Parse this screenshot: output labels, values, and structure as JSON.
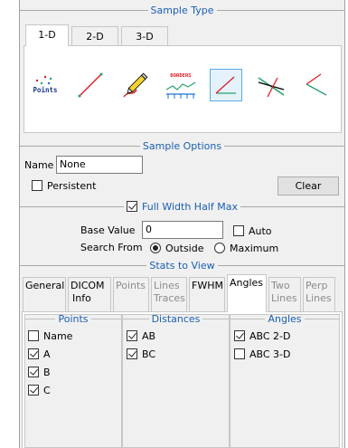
{
  "sample_type": {
    "title": "Sample Type",
    "tabs": [
      "1-D",
      "2-D",
      "3-D"
    ],
    "active_tab": "1-D",
    "samples": [
      {
        "name": "points",
        "label": "Points"
      },
      {
        "name": "line"
      },
      {
        "name": "pencil"
      },
      {
        "name": "borders",
        "label": "BORDERS"
      },
      {
        "name": "angle",
        "selected": true
      },
      {
        "name": "crossing-lines"
      },
      {
        "name": "angle-2"
      }
    ]
  },
  "sample_options": {
    "title": "Sample Options",
    "name_label": "Name",
    "name_value": "None",
    "persistent_label": "Persistent",
    "persistent_checked": false,
    "clear_label": "Clear"
  },
  "fwhm": {
    "label": "Full Width Half Max",
    "checked": true,
    "base_value_label": "Base Value",
    "base_value": "0",
    "auto_label": "Auto",
    "auto_checked": false,
    "search_from_label": "Search From",
    "outside_label": "Outside",
    "maximum_label": "Maximum",
    "search_from": "Outside"
  },
  "stats": {
    "title": "Stats to View",
    "tabs": [
      {
        "line1": "General",
        "line2": "",
        "state": "normal"
      },
      {
        "line1": "DICOM",
        "line2": "Info",
        "state": "normal"
      },
      {
        "line1": "Points",
        "line2": "",
        "state": "disabled"
      },
      {
        "line1": "Lines",
        "line2": "Traces",
        "state": "disabled"
      },
      {
        "line1": "FWHM",
        "line2": "",
        "state": "normal"
      },
      {
        "line1": "Angles",
        "line2": "",
        "state": "active"
      },
      {
        "line1": "Two",
        "line2": "Lines",
        "state": "disabled"
      },
      {
        "line1": "Perp",
        "line2": "Lines",
        "state": "disabled"
      }
    ],
    "points": {
      "title": "Points",
      "items": [
        {
          "label": "Name",
          "checked": false
        },
        {
          "label": "A",
          "checked": true
        },
        {
          "label": "B",
          "checked": true
        },
        {
          "label": "C",
          "checked": true
        }
      ]
    },
    "distances": {
      "title": "Distances",
      "items": [
        {
          "label": "AB",
          "checked": true
        },
        {
          "label": "BC",
          "checked": true
        }
      ]
    },
    "angles": {
      "title": "Angles",
      "items": [
        {
          "label": "ABC 2-D",
          "checked": true
        },
        {
          "label": "ABC 3-D",
          "checked": false
        }
      ]
    }
  },
  "colors": {
    "group_title": "#1a5fb4",
    "selection": "#5aa9e6",
    "line_red": "#e01b24",
    "line_green": "#26a269"
  }
}
